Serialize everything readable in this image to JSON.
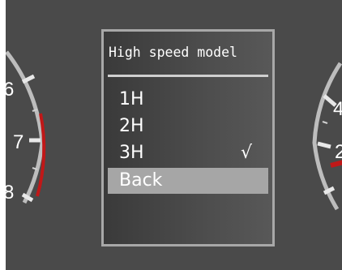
{
  "menu": {
    "title": "High speed model",
    "items": [
      {
        "id": "1h",
        "label": "1H",
        "checked": false,
        "selected": false
      },
      {
        "id": "2h",
        "label": "2H",
        "checked": false,
        "selected": false
      },
      {
        "id": "3h",
        "label": "3H",
        "checked": true,
        "selected": false
      },
      {
        "id": "back",
        "label": "Back",
        "checked": false,
        "selected": true
      }
    ],
    "check_glyph": "√"
  },
  "left_gauge": {
    "scale_labels": [
      "6",
      "7",
      "8"
    ],
    "redline_color": "#c01818"
  },
  "right_gauge": {
    "scale_labels": [
      "4",
      "2"
    ],
    "needle_color": "#c01818"
  },
  "colors": {
    "background": "#4a4a4a",
    "panel_border": "#a8a8a8",
    "selected_highlight": "#a6a6a6",
    "text": "#ffffff"
  }
}
